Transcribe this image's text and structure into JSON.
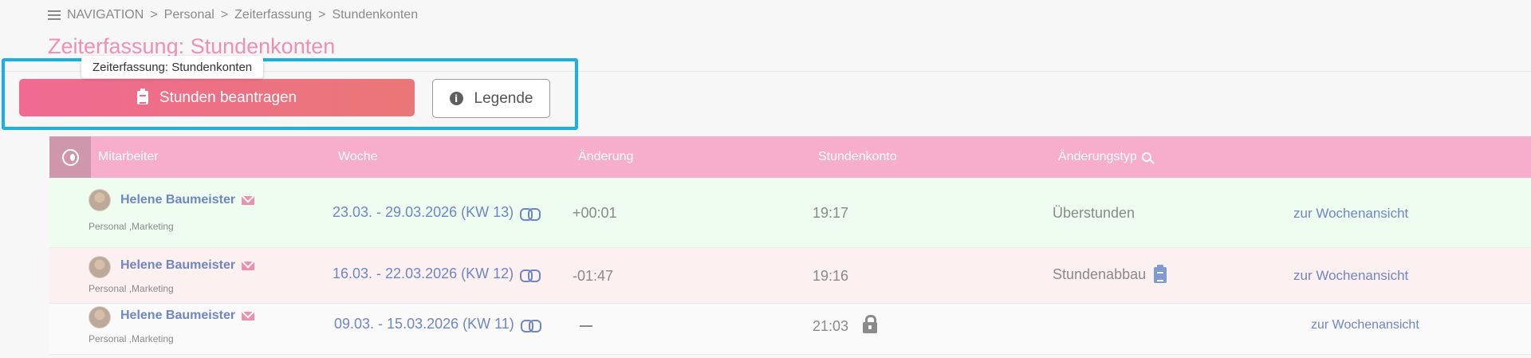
{
  "nav": {
    "label": "NAVIGATION",
    "crumbs": [
      "Personal",
      "Zeiterfassung",
      "Stundenkonten"
    ],
    "separator": ">"
  },
  "page": {
    "title": "Zeiterfassung: Stundenkonten"
  },
  "tooltip": {
    "text": "Zeiterfassung: Stundenkonten"
  },
  "toolbar": {
    "primary_label": "Stunden beantragen",
    "secondary_label": "Legende"
  },
  "table": {
    "headers": {
      "employee": "Mitarbeiter",
      "week": "Woche",
      "change": "Änderung",
      "account": "Stundenkonto",
      "change_type": "Änderungstyp"
    },
    "rows": [
      {
        "name": "Helene Baumeister",
        "dept": "Personal ,Marketing",
        "week": "23.03. - 29.03.2026 (KW 13)",
        "change": "+00:01",
        "account": "19:17",
        "type": "Überstunden",
        "link": "zur Wochenansicht",
        "status": "approved"
      },
      {
        "name": "Helene Baumeister",
        "dept": "Personal ,Marketing",
        "week": "16.03. - 22.03.2026 (KW 12)",
        "change": "-01:47",
        "account": "19:16",
        "type": "Stundenabbau",
        "link": "zur Wochenansicht",
        "status": "reduction"
      },
      {
        "name": "Helene Baumeister",
        "dept": "Personal ,Marketing",
        "week": "09.03. - 15.03.2026 (KW 11)",
        "change": "",
        "account": "21:03",
        "type": "",
        "link": "zur Wochenansicht",
        "status": "locked"
      }
    ]
  },
  "colors": {
    "accent": "#ef8fb4",
    "header_bg": "#f6aecb",
    "link": "#6f86c6",
    "row_green": "#effcf0",
    "row_red": "#fdf0f1",
    "highlight": "#1bb0e4"
  },
  "icons": [
    "hamburger-icon",
    "clipboard-icon",
    "info-icon",
    "toggle-icon",
    "search-icon",
    "avatar",
    "mail-icon",
    "link-icon",
    "lock-icon"
  ]
}
